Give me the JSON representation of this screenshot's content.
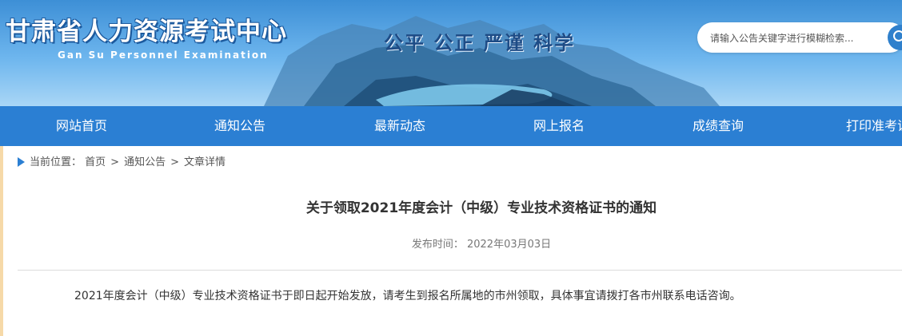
{
  "header": {
    "title": "甘肃省人力资源考试中心",
    "subtitle": "Gan Su Personnel Examination",
    "slogan": "公平 公正 严谨 科学",
    "search_placeholder": "请输入公告关键字进行模糊检索...",
    "search_icon": "search-icon"
  },
  "nav": {
    "items": [
      {
        "label": "网站首页"
      },
      {
        "label": "通知公告"
      },
      {
        "label": "最新动态"
      },
      {
        "label": "网上报名"
      },
      {
        "label": "成绩查询"
      },
      {
        "label": "打印准考证"
      }
    ]
  },
  "breadcrumb": {
    "prefix": "当前位置：",
    "items": [
      "首页",
      "通知公告",
      "文章详情"
    ],
    "separator": ">"
  },
  "article": {
    "title": "关于领取2021年度会计（中级）专业技术资格证书的通知",
    "date_label": "发布时间：",
    "date": "2022年03月03日",
    "body": "2021年度会计（中级）专业技术资格证书于即日起开始发放，请考生到报名所属地的市州领取，具体事宜请拨打各市州联系电话咨询。"
  },
  "colors": {
    "nav_bg": "#2b7fd3",
    "header_sky": "#6eb6ee",
    "accent": "#2b7fd3"
  }
}
